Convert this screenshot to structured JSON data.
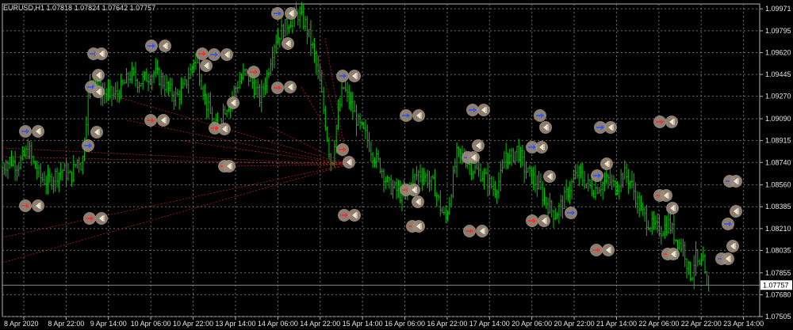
{
  "header": {
    "symbol": "EURUSD,H1",
    "ohlc": "1.07818 1.07824 1.07642 1.07757"
  },
  "colors": {
    "background": "#000000",
    "grid": "#6e6e6e",
    "candle": "#00c800",
    "axis": "#b4b4b4",
    "text": "#e6e6e6",
    "ray": "#c81e1e",
    "marker_fill": "#9b8c7c",
    "arrow_blue": "#2a55ff",
    "arrow_red": "#ff2a2a",
    "current_price_line": "#b4b4b4"
  },
  "chart_data": {
    "type": "candlestick",
    "symbol": "EURUSD",
    "timeframe": "H1",
    "y_ticks": [
      "1.09971",
      "1.09795",
      "1.09620",
      "1.09445",
      "1.09270",
      "1.09090",
      "1.08915",
      "1.08740",
      "1.08560",
      "1.08385",
      "1.08210",
      "1.08035",
      "1.07855",
      "1.07680",
      "1.07505"
    ],
    "ylim": [
      1.07505,
      1.1001
    ],
    "current_price": "1.07757",
    "x_ticks": [
      "8 Apr 2020",
      "8 Apr 22:00",
      "9 Apr 14:00",
      "10 Apr 06:00",
      "10 Apr 22:00",
      "13 Apr 14:00",
      "14 Apr 06:00",
      "14 Apr 22:00",
      "15 Apr 14:00",
      "16 Apr 06:00",
      "16 Apr 22:00",
      "17 Apr 14:00",
      "20 Apr 06:00",
      "20 Apr 22:00",
      "21 Apr 14:00",
      "22 Apr 06:00",
      "22 Apr 22:00",
      "23 Apr 14:00"
    ],
    "close_path": [
      [
        0.0,
        1.087
      ],
      [
        0.01,
        1.0876
      ],
      [
        0.02,
        1.0872
      ],
      [
        0.03,
        1.088
      ],
      [
        0.035,
        1.0885
      ],
      [
        0.04,
        1.0874
      ],
      [
        0.05,
        1.0862
      ],
      [
        0.06,
        1.0858
      ],
      [
        0.07,
        1.0864
      ],
      [
        0.08,
        1.0868
      ],
      [
        0.09,
        1.0862
      ],
      [
        0.1,
        1.0878
      ],
      [
        0.105,
        1.087
      ],
      [
        0.11,
        1.0905
      ],
      [
        0.115,
        1.0935
      ],
      [
        0.12,
        1.0945
      ],
      [
        0.13,
        1.093
      ],
      [
        0.15,
        1.0928
      ],
      [
        0.16,
        1.0936
      ],
      [
        0.17,
        1.0945
      ],
      [
        0.18,
        1.0938
      ],
      [
        0.19,
        1.0942
      ],
      [
        0.2,
        1.0946
      ],
      [
        0.21,
        1.094
      ],
      [
        0.22,
        1.0932
      ],
      [
        0.23,
        1.0926
      ],
      [
        0.24,
        1.0934
      ],
      [
        0.25,
        1.095
      ],
      [
        0.255,
        1.096
      ],
      [
        0.26,
        1.0946
      ],
      [
        0.27,
        1.092
      ],
      [
        0.28,
        1.0904
      ],
      [
        0.285,
        1.09
      ],
      [
        0.29,
        1.0915
      ],
      [
        0.3,
        1.0922
      ],
      [
        0.31,
        1.0936
      ],
      [
        0.32,
        1.0946
      ],
      [
        0.33,
        1.0938
      ],
      [
        0.34,
        1.0925
      ],
      [
        0.35,
        1.0945
      ],
      [
        0.355,
        1.096
      ],
      [
        0.36,
        1.0972
      ],
      [
        0.37,
        1.098
      ],
      [
        0.38,
        1.0988
      ],
      [
        0.39,
        1.0993
      ],
      [
        0.4,
        1.0985
      ],
      [
        0.41,
        1.0965
      ],
      [
        0.42,
        1.0935
      ],
      [
        0.43,
        1.089
      ],
      [
        0.435,
        1.087
      ],
      [
        0.44,
        1.09
      ],
      [
        0.45,
        1.0935
      ],
      [
        0.46,
        1.092
      ],
      [
        0.47,
        1.0905
      ],
      [
        0.48,
        1.0895
      ],
      [
        0.49,
        1.088
      ],
      [
        0.5,
        1.087
      ],
      [
        0.51,
        1.0855
      ],
      [
        0.52,
        1.0852
      ],
      [
        0.53,
        1.0845
      ],
      [
        0.54,
        1.0858
      ],
      [
        0.55,
        1.0866
      ],
      [
        0.56,
        1.0862
      ],
      [
        0.57,
        1.0855
      ],
      [
        0.58,
        1.0835
      ],
      [
        0.585,
        1.0828
      ],
      [
        0.59,
        1.0842
      ],
      [
        0.6,
        1.088
      ],
      [
        0.61,
        1.0878
      ],
      [
        0.62,
        1.087
      ],
      [
        0.63,
        1.0866
      ],
      [
        0.64,
        1.086
      ],
      [
        0.65,
        1.0852
      ],
      [
        0.66,
        1.0865
      ],
      [
        0.665,
        1.0882
      ],
      [
        0.67,
        1.0876
      ],
      [
        0.68,
        1.0885
      ],
      [
        0.69,
        1.0868
      ],
      [
        0.7,
        1.0862
      ],
      [
        0.71,
        1.0852
      ],
      [
        0.72,
        1.084
      ],
      [
        0.73,
        1.0832
      ],
      [
        0.74,
        1.0842
      ],
      [
        0.75,
        1.0855
      ],
      [
        0.76,
        1.0866
      ],
      [
        0.77,
        1.0858
      ],
      [
        0.78,
        1.0852
      ],
      [
        0.79,
        1.0856
      ],
      [
        0.8,
        1.086
      ],
      [
        0.81,
        1.0854
      ],
      [
        0.82,
        1.0866
      ],
      [
        0.83,
        1.0858
      ],
      [
        0.84,
        1.084
      ],
      [
        0.85,
        1.0828
      ],
      [
        0.86,
        1.0822
      ],
      [
        0.87,
        1.082
      ],
      [
        0.88,
        1.0825
      ],
      [
        0.89,
        1.0812
      ],
      [
        0.9,
        1.0805
      ],
      [
        0.905,
        1.079
      ],
      [
        0.91,
        1.0782
      ],
      [
        0.915,
        1.08
      ],
      [
        0.92,
        1.0788
      ],
      [
        0.925,
        1.0795
      ],
      [
        0.93,
        1.0772
      ],
      [
        0.935,
        1.0776
      ]
    ],
    "markers": [
      {
        "pos": [
          350,
          17
        ],
        "arrow": "right",
        "color": "blue"
      },
      {
        "pos": [
          367,
          17
        ],
        "arrow": "left",
        "color": "blue"
      },
      {
        "pos": [
          118,
          68
        ],
        "arrow": "right",
        "color": "blue"
      },
      {
        "pos": [
          128,
          68
        ],
        "arrow": "left",
        "color": "blue"
      },
      {
        "pos": [
          191,
          58
        ],
        "arrow": "right",
        "color": "blue"
      },
      {
        "pos": [
          208,
          58
        ],
        "arrow": "left",
        "color": "blue"
      },
      {
        "pos": [
          255,
          68
        ],
        "arrow": "right",
        "color": "red"
      },
      {
        "pos": [
          270,
          69
        ],
        "arrow": "right",
        "color": "blue"
      },
      {
        "pos": [
          286,
          69
        ],
        "arrow": "left",
        "color": "blue"
      },
      {
        "pos": [
          124,
          95
        ],
        "arrow": "left",
        "color": "red"
      },
      {
        "pos": [
          115,
          110
        ],
        "arrow": "right",
        "color": "blue"
      },
      {
        "pos": [
          124,
          116
        ],
        "arrow": "left",
        "color": "red"
      },
      {
        "pos": [
          260,
          83
        ],
        "arrow": "left",
        "color": "red"
      },
      {
        "pos": [
          320,
          91
        ],
        "arrow": "right",
        "color": "red"
      },
      {
        "pos": [
          350,
          111
        ],
        "arrow": "right",
        "color": "red"
      },
      {
        "pos": [
          366,
          110
        ],
        "arrow": "left",
        "color": "red"
      },
      {
        "pos": [
          363,
          55
        ],
        "arrow": "left",
        "color": "red"
      },
      {
        "pos": [
          432,
          96
        ],
        "arrow": "right",
        "color": "blue"
      },
      {
        "pos": [
          447,
          96
        ],
        "arrow": "left",
        "color": "blue"
      },
      {
        "pos": [
          294,
          130
        ],
        "arrow": "left",
        "color": "red"
      },
      {
        "pos": [
          190,
          152
        ],
        "arrow": "right",
        "color": "red"
      },
      {
        "pos": [
          206,
          152
        ],
        "arrow": "left",
        "color": "red"
      },
      {
        "pos": [
          271,
          162
        ],
        "arrow": "right",
        "color": "red"
      },
      {
        "pos": [
          283,
          163
        ],
        "arrow": "left",
        "color": "red"
      },
      {
        "pos": [
          32,
          166
        ],
        "arrow": "right",
        "color": "blue"
      },
      {
        "pos": [
          48,
          166
        ],
        "arrow": "left",
        "color": "blue"
      },
      {
        "pos": [
          122,
          167
        ],
        "arrow": "left",
        "color": "blue"
      },
      {
        "pos": [
          111,
          184
        ],
        "arrow": "right",
        "color": "blue"
      },
      {
        "pos": [
          432,
          189
        ],
        "arrow": "right",
        "color": "red"
      },
      {
        "pos": [
          440,
          205
        ],
        "arrow": "left",
        "color": "red"
      },
      {
        "pos": [
          283,
          210
        ],
        "arrow": "right",
        "color": "red"
      },
      {
        "pos": [
          289,
          210
        ],
        "arrow": "left",
        "color": "red"
      },
      {
        "pos": [
          32,
          260
        ],
        "arrow": "right",
        "color": "red"
      },
      {
        "pos": [
          48,
          260
        ],
        "arrow": "left",
        "color": "red"
      },
      {
        "pos": [
          113,
          276
        ],
        "arrow": "right",
        "color": "red"
      },
      {
        "pos": [
          128,
          276
        ],
        "arrow": "left",
        "color": "red"
      },
      {
        "pos": [
          434,
          272
        ],
        "arrow": "right",
        "color": "red"
      },
      {
        "pos": [
          447,
          272
        ],
        "arrow": "left",
        "color": "red"
      },
      {
        "pos": [
          512,
          146
        ],
        "arrow": "right",
        "color": "blue"
      },
      {
        "pos": [
          528,
          146
        ],
        "arrow": "left",
        "color": "blue"
      },
      {
        "pos": [
          596,
          139
        ],
        "arrow": "right",
        "color": "blue"
      },
      {
        "pos": [
          610,
          139
        ],
        "arrow": "left",
        "color": "blue"
      },
      {
        "pos": [
          681,
          146
        ],
        "arrow": "right",
        "color": "blue"
      },
      {
        "pos": [
          688,
          161
        ],
        "arrow": "left",
        "color": "blue"
      },
      {
        "pos": [
          757,
          161
        ],
        "arrow": "right",
        "color": "blue"
      },
      {
        "pos": [
          770,
          161
        ],
        "arrow": "left",
        "color": "blue"
      },
      {
        "pos": [
          832,
          154
        ],
        "arrow": "right",
        "color": "red"
      },
      {
        "pos": [
          847,
          154
        ],
        "arrow": "left",
        "color": "red"
      },
      {
        "pos": [
          603,
          184
        ],
        "arrow": "left",
        "color": "blue"
      },
      {
        "pos": [
          590,
          199
        ],
        "arrow": "right",
        "color": "blue"
      },
      {
        "pos": [
          597,
          199
        ],
        "arrow": "left",
        "color": "blue"
      },
      {
        "pos": [
          671,
          186
        ],
        "arrow": "right",
        "color": "blue"
      },
      {
        "pos": [
          683,
          186
        ],
        "arrow": "left",
        "color": "blue"
      },
      {
        "pos": [
          693,
          223
        ],
        "arrow": "left",
        "color": "blue"
      },
      {
        "pos": [
          753,
          222
        ],
        "arrow": "right",
        "color": "blue"
      },
      {
        "pos": [
          765,
          207
        ],
        "arrow": "left",
        "color": "blue"
      },
      {
        "pos": [
          512,
          240
        ],
        "arrow": "right",
        "color": "red"
      },
      {
        "pos": [
          522,
          240
        ],
        "arrow": "left",
        "color": "red"
      },
      {
        "pos": [
          527,
          255
        ],
        "arrow": "left",
        "color": "red"
      },
      {
        "pos": [
          520,
          286
        ],
        "arrow": "right",
        "color": "red"
      },
      {
        "pos": [
          528,
          286
        ],
        "arrow": "left",
        "color": "red"
      },
      {
        "pos": [
          592,
          292
        ],
        "arrow": "right",
        "color": "red"
      },
      {
        "pos": [
          608,
          292
        ],
        "arrow": "left",
        "color": "red"
      },
      {
        "pos": [
          671,
          279
        ],
        "arrow": "right",
        "color": "red"
      },
      {
        "pos": [
          686,
          279
        ],
        "arrow": "left",
        "color": "red"
      },
      {
        "pos": [
          720,
          269
        ],
        "arrow": "right",
        "color": "blue"
      },
      {
        "pos": [
          752,
          316
        ],
        "arrow": "right",
        "color": "red"
      },
      {
        "pos": [
          767,
          316
        ],
        "arrow": "left",
        "color": "red"
      },
      {
        "pos": [
          832,
          247
        ],
        "arrow": "right",
        "color": "red"
      },
      {
        "pos": [
          840,
          247
        ],
        "arrow": "left",
        "color": "red"
      },
      {
        "pos": [
          848,
          263
        ],
        "arrow": "left",
        "color": "red"
      },
      {
        "pos": [
          842,
          321
        ],
        "arrow": "right",
        "color": "red"
      },
      {
        "pos": [
          849,
          321
        ],
        "arrow": "left",
        "color": "red"
      },
      {
        "pos": [
          920,
          229
        ],
        "arrow": "right",
        "color": "blue"
      },
      {
        "pos": [
          928,
          229
        ],
        "arrow": "left",
        "color": "blue"
      },
      {
        "pos": [
          928,
          267
        ],
        "arrow": "left",
        "color": "blue"
      },
      {
        "pos": [
          918,
          283
        ],
        "arrow": "right",
        "color": "blue"
      },
      {
        "pos": [
          924,
          311
        ],
        "arrow": "left",
        "color": "blue"
      },
      {
        "pos": [
          910,
          327
        ],
        "arrow": "right",
        "color": "blue"
      },
      {
        "pos": [
          918,
          327
        ],
        "arrow": "left",
        "color": "blue"
      }
    ]
  }
}
